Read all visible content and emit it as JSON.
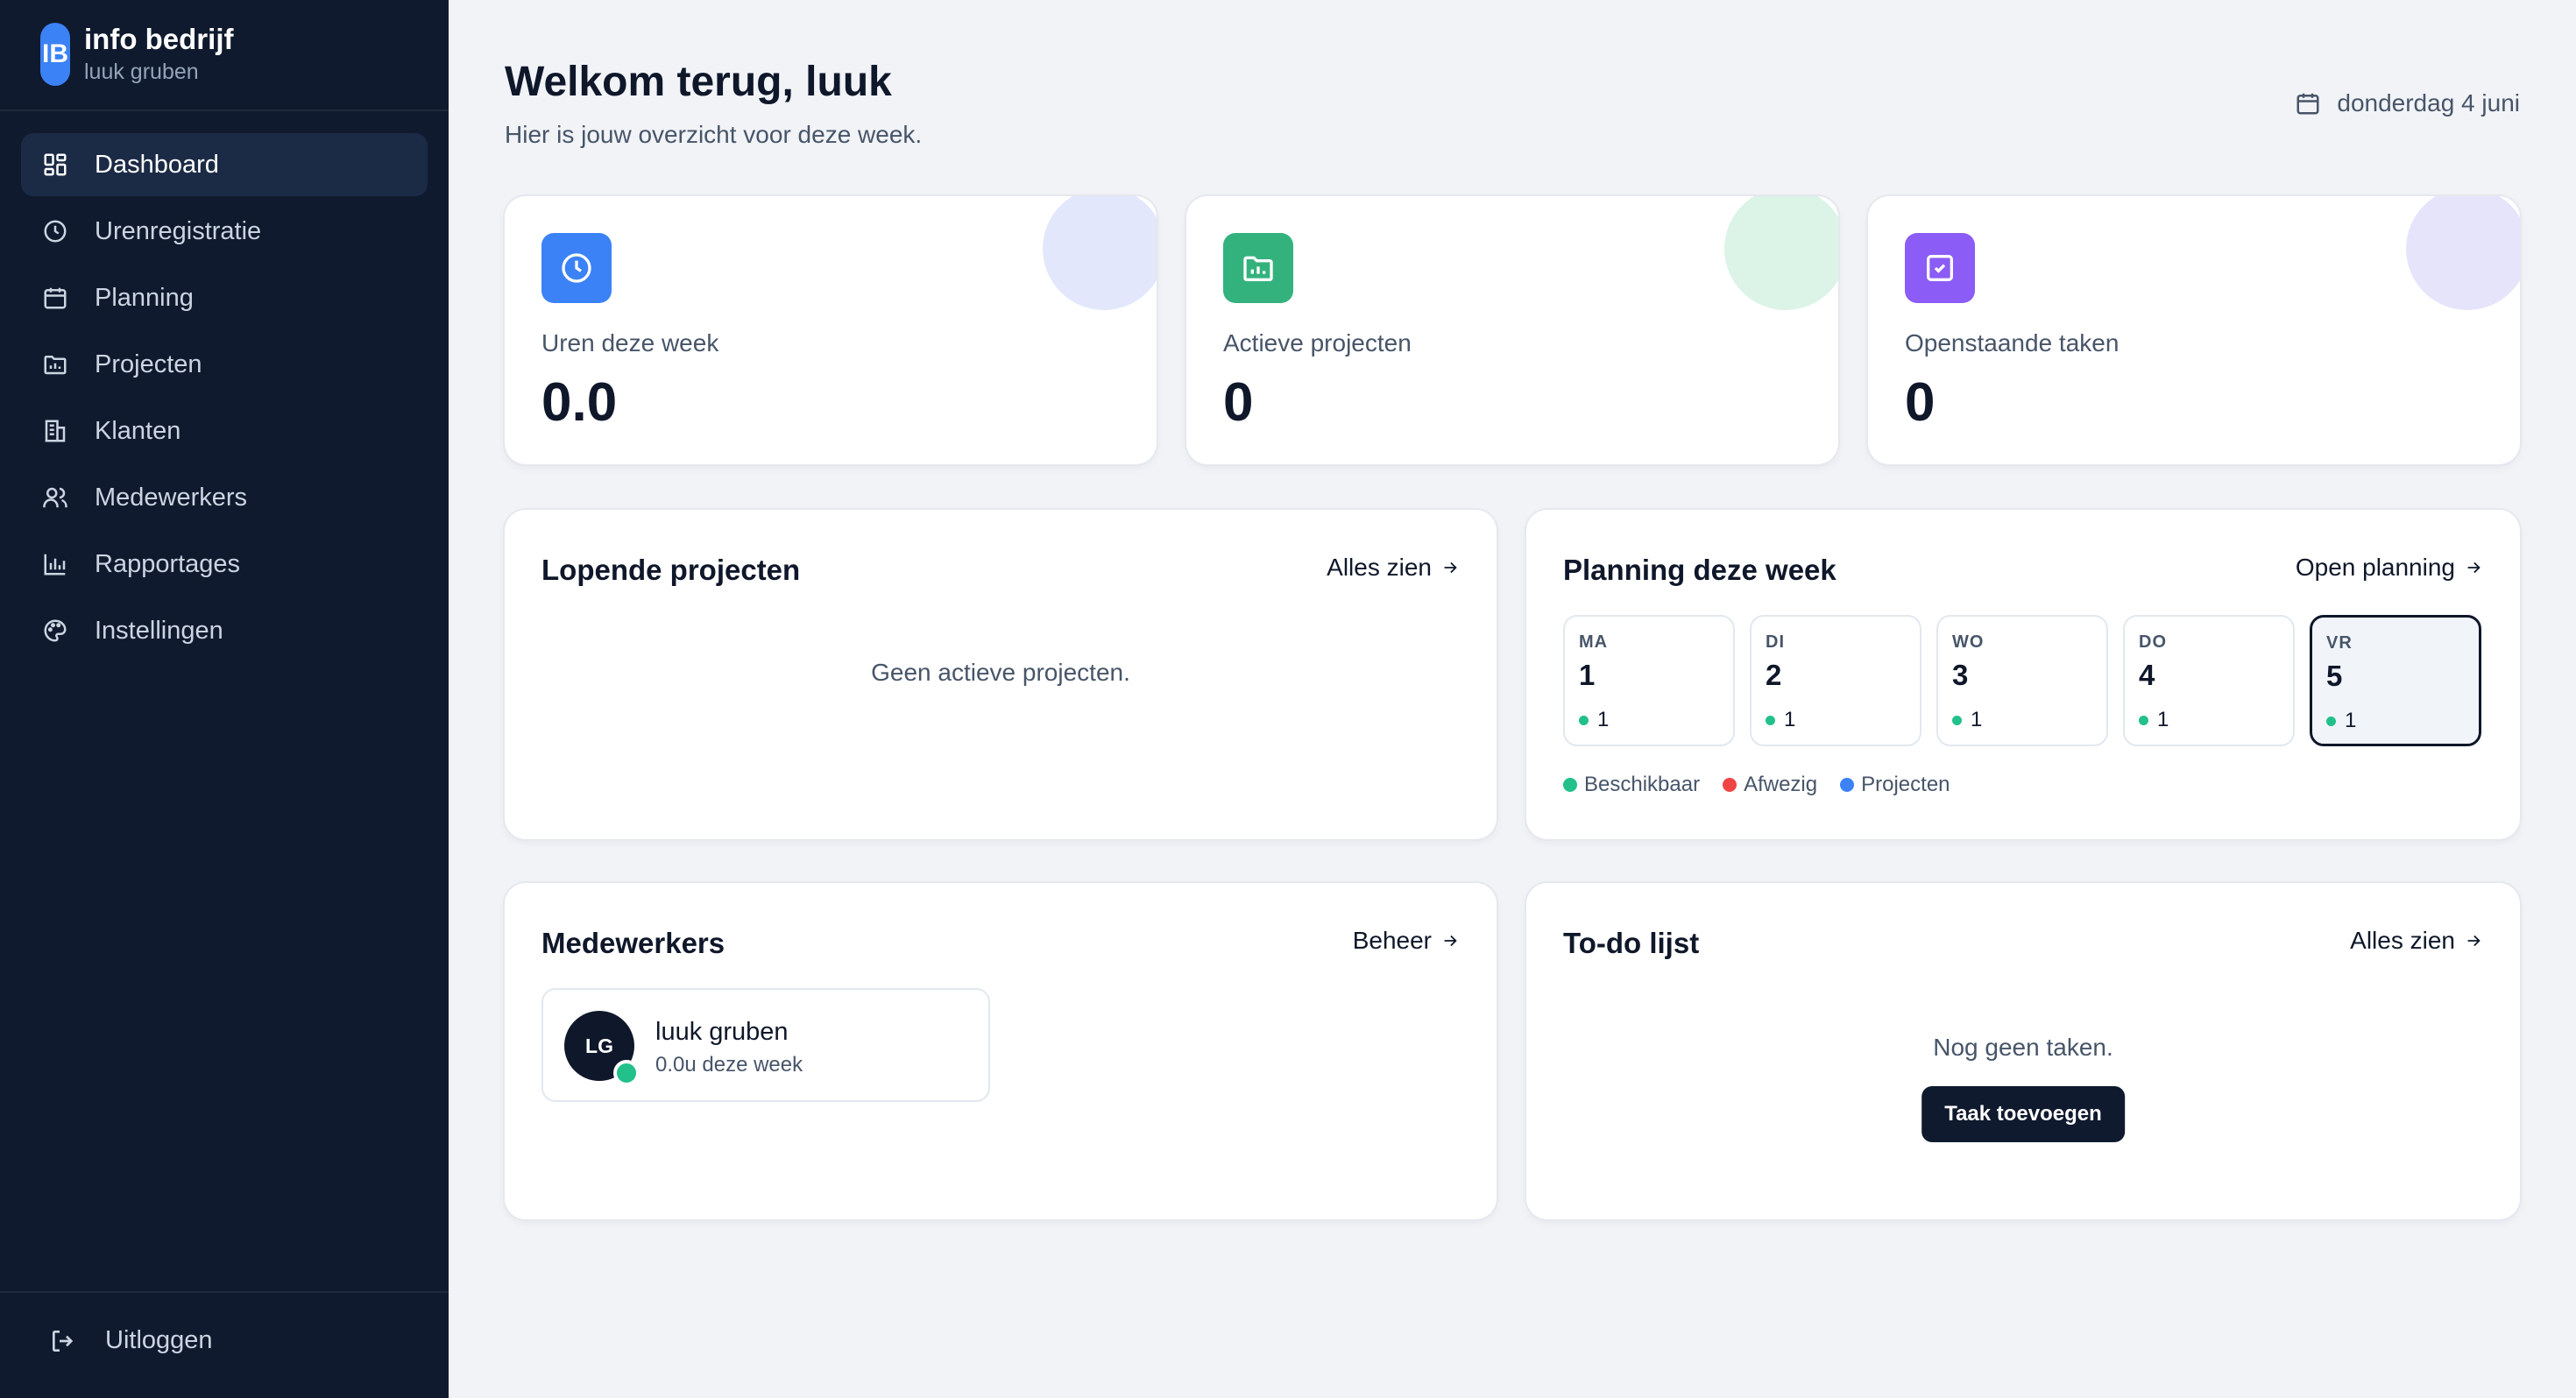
{
  "brand": {
    "logo": "IB",
    "name": "info bedrijf",
    "user": "luuk gruben"
  },
  "sidebar": {
    "items": [
      {
        "label": "Dashboard",
        "icon": "grid-icon",
        "active": true
      },
      {
        "label": "Urenregistratie",
        "icon": "clock-icon"
      },
      {
        "label": "Planning",
        "icon": "calendar-icon"
      },
      {
        "label": "Projecten",
        "icon": "folder-icon"
      },
      {
        "label": "Klanten",
        "icon": "building-icon"
      },
      {
        "label": "Medewerkers",
        "icon": "users-icon"
      },
      {
        "label": "Rapportages",
        "icon": "bar-chart-icon"
      },
      {
        "label": "Instellingen",
        "icon": "palette-icon"
      }
    ],
    "logout": "Uitloggen"
  },
  "header": {
    "title": "Welkom terug, luuk",
    "subtitle": "Hier is jouw overzicht voor deze week.",
    "date": "donderdag 4 juni"
  },
  "stats": [
    {
      "label": "Uren deze week",
      "value": "0.0",
      "icon": "clock-icon",
      "color": "#3b82f6",
      "blob": "#e3e7fb"
    },
    {
      "label": "Actieve projecten",
      "value": "0",
      "icon": "folder-icon",
      "color": "#34b27d",
      "blob": "#dcf3e8"
    },
    {
      "label": "Openstaande taken",
      "value": "0",
      "icon": "check-square-icon",
      "color": "#8b5cf6",
      "blob": "#e5e4fb"
    }
  ],
  "projects": {
    "title": "Lopende projecten",
    "link": "Alles zien",
    "empty": "Geen actieve projecten."
  },
  "planning": {
    "title": "Planning deze week",
    "link": "Open planning",
    "days": [
      {
        "name": "MA",
        "date": "1",
        "count": "1"
      },
      {
        "name": "DI",
        "date": "2",
        "count": "1"
      },
      {
        "name": "WO",
        "date": "3",
        "count": "1"
      },
      {
        "name": "DO",
        "date": "4",
        "count": "1"
      },
      {
        "name": "VR",
        "date": "5",
        "count": "1"
      }
    ],
    "legend": [
      {
        "label": "Beschikbaar",
        "color": "#22c08a"
      },
      {
        "label": "Afwezig",
        "color": "#ef4444"
      },
      {
        "label": "Projecten",
        "color": "#3b82f6"
      }
    ]
  },
  "employees": {
    "title": "Medewerkers",
    "link": "Beheer",
    "members": [
      {
        "initials": "LG",
        "name": "luuk gruben",
        "hours": "0.0u deze week"
      }
    ]
  },
  "todo": {
    "title": "To-do lijst",
    "link": "Alles zien",
    "empty": "Nog geen taken.",
    "button": "Taak toevoegen"
  }
}
